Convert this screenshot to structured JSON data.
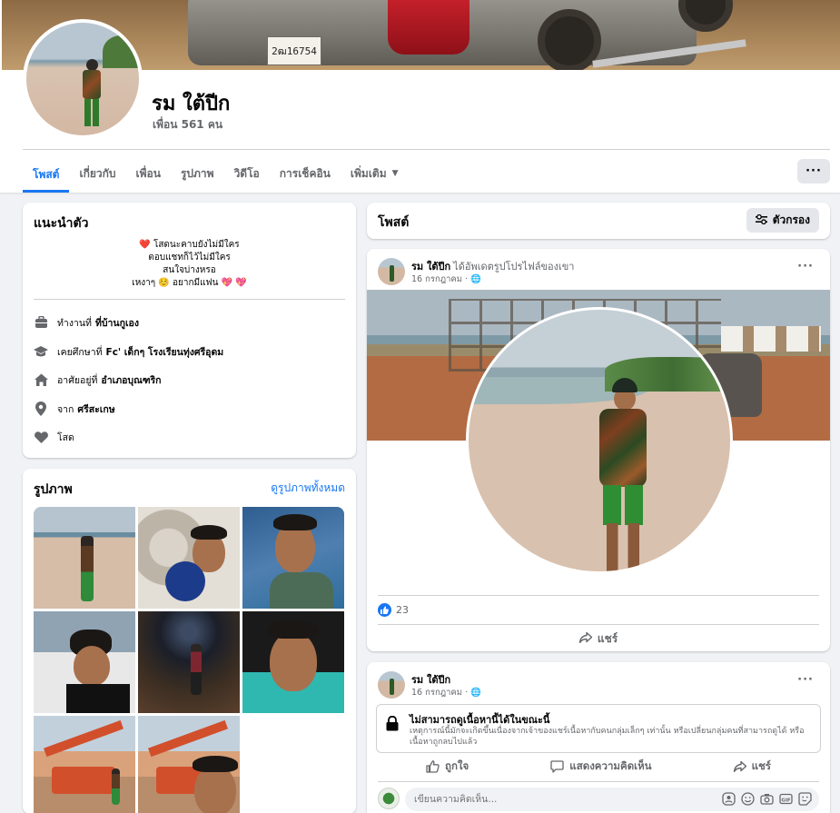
{
  "profile": {
    "name": "รม ใต้ปีก",
    "friends": "เพื่อน 561 คน",
    "cover_plate": "2ฒ16754"
  },
  "tabs": [
    {
      "label": "โพสต์",
      "active": true
    },
    {
      "label": "เกี่ยวกับ",
      "active": false
    },
    {
      "label": "เพื่อน",
      "active": false
    },
    {
      "label": "รูปภาพ",
      "active": false
    },
    {
      "label": "วิดีโอ",
      "active": false
    },
    {
      "label": "การเช็คอิน",
      "active": false
    },
    {
      "label": "เพิ่มเติม",
      "active": false
    }
  ],
  "more_button": "···",
  "intro": {
    "title": "แนะนำตัว",
    "bio": [
      "❤️ โสดนะคาบยังไม่มีใคร",
      "ตอบแชทก็ไว้ไม่มีใคร",
      "สนใจบ่างหรอ",
      "เหงาๆ ☺️ อยากมีแฟน 💖 💖"
    ],
    "work_prefix": "ทำงานที่",
    "work_place": "ที่บ้านกูเอง",
    "edu_prefix": "เคยศึกษาที่",
    "edu_place": "Fc' เด็กๆ โรงเรียนทุ่งศรีอุดม",
    "live_prefix": "อาศัยอยู่ที่",
    "live_place": "อำเภอบุณฑริก",
    "from_prefix": "จาก",
    "from_place": "ศรีสะเกษ",
    "relationship": "โสด"
  },
  "photos": {
    "title": "รูปภาพ",
    "see_all": "ดูรูปภาพทั้งหมด"
  },
  "posts_header": {
    "title": "โพสต์",
    "filter": "ตัวกรอง"
  },
  "post1": {
    "author": "รม ใต้ปีก",
    "action": "ได้อัพเดตรูปโปรไฟล์ของเขา",
    "date": "16 กรกฎาคม · 🌐",
    "likes": "23",
    "share": "แชร์"
  },
  "post2": {
    "author": "รม ใต้ปีก",
    "date": "16 กรกฎาคม · 🌐",
    "unavailable_title": "ไม่สามารถดูเนื้อหานี้ได้ในขณะนี้",
    "unavailable_text": "เหตุการณ์นี้มักจะเกิดขึ้นเนื่องจากเจ้าของแชร์เนื้อหากับคนกลุ่มเล็กๆ เท่านั้น หรือเปลี่ยนกลุ่มคนที่สามารถดูได้ หรือเนื้อหาถูกลบไปแล้ว",
    "like": "ถูกใจ",
    "comment": "แสดงความคิดเห็น",
    "share": "แชร์",
    "comment_placeholder": "เขียนความคิดเห็น..."
  },
  "colors": {
    "accent": "#1877f2",
    "background": "#f0f2f5",
    "secondary_text": "#65676b"
  }
}
